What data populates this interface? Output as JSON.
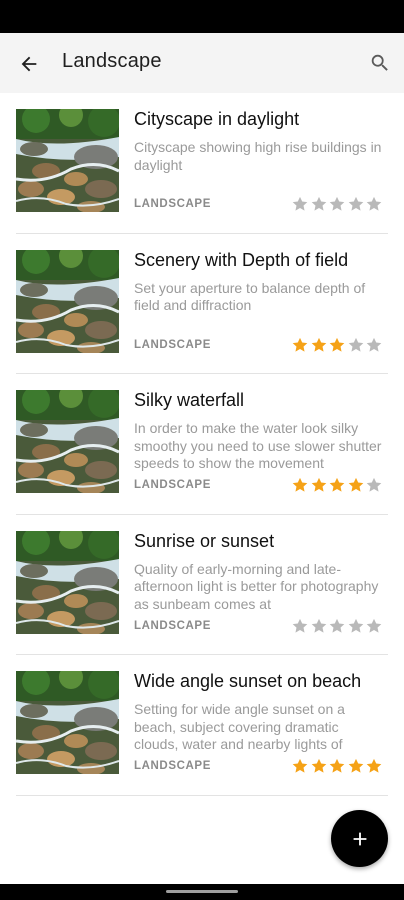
{
  "app_bar": {
    "title": "Landscape",
    "back_icon": "arrow-left-icon",
    "search_icon": "search-icon",
    "background": "#f4f4f4"
  },
  "colors": {
    "star_filled": "#f5a217",
    "star_empty": "#b9b9b9",
    "fab": "#000000"
  },
  "items": [
    {
      "title": "Cityscape in daylight",
      "description": "Cityscape showing high rise buildings in daylight",
      "category": "LANDSCAPE",
      "rating": 0,
      "max_rating": 5
    },
    {
      "title": "Scenery with Depth of field",
      "description": "Set your aperture to balance depth of field and diffraction",
      "category": "LANDSCAPE",
      "rating": 3,
      "max_rating": 5
    },
    {
      "title": "Silky waterfall",
      "description": "In order to make the water look silky smoothy you need to use slower shutter speeds to show the movement",
      "category": "LANDSCAPE",
      "rating": 4,
      "max_rating": 5
    },
    {
      "title": "Sunrise or sunset",
      "description": "Quality of early-morning and late-afternoon light is better for photography as sunbeam comes at",
      "category": "LANDSCAPE",
      "rating": 0,
      "max_rating": 5
    },
    {
      "title": "Wide angle sunset on beach",
      "description": "Setting for wide angle sunset on a beach, subject covering dramatic clouds, water and nearby lights of",
      "category": "LANDSCAPE",
      "rating": 5,
      "max_rating": 5
    }
  ],
  "fab": {
    "icon": "plus-icon"
  }
}
